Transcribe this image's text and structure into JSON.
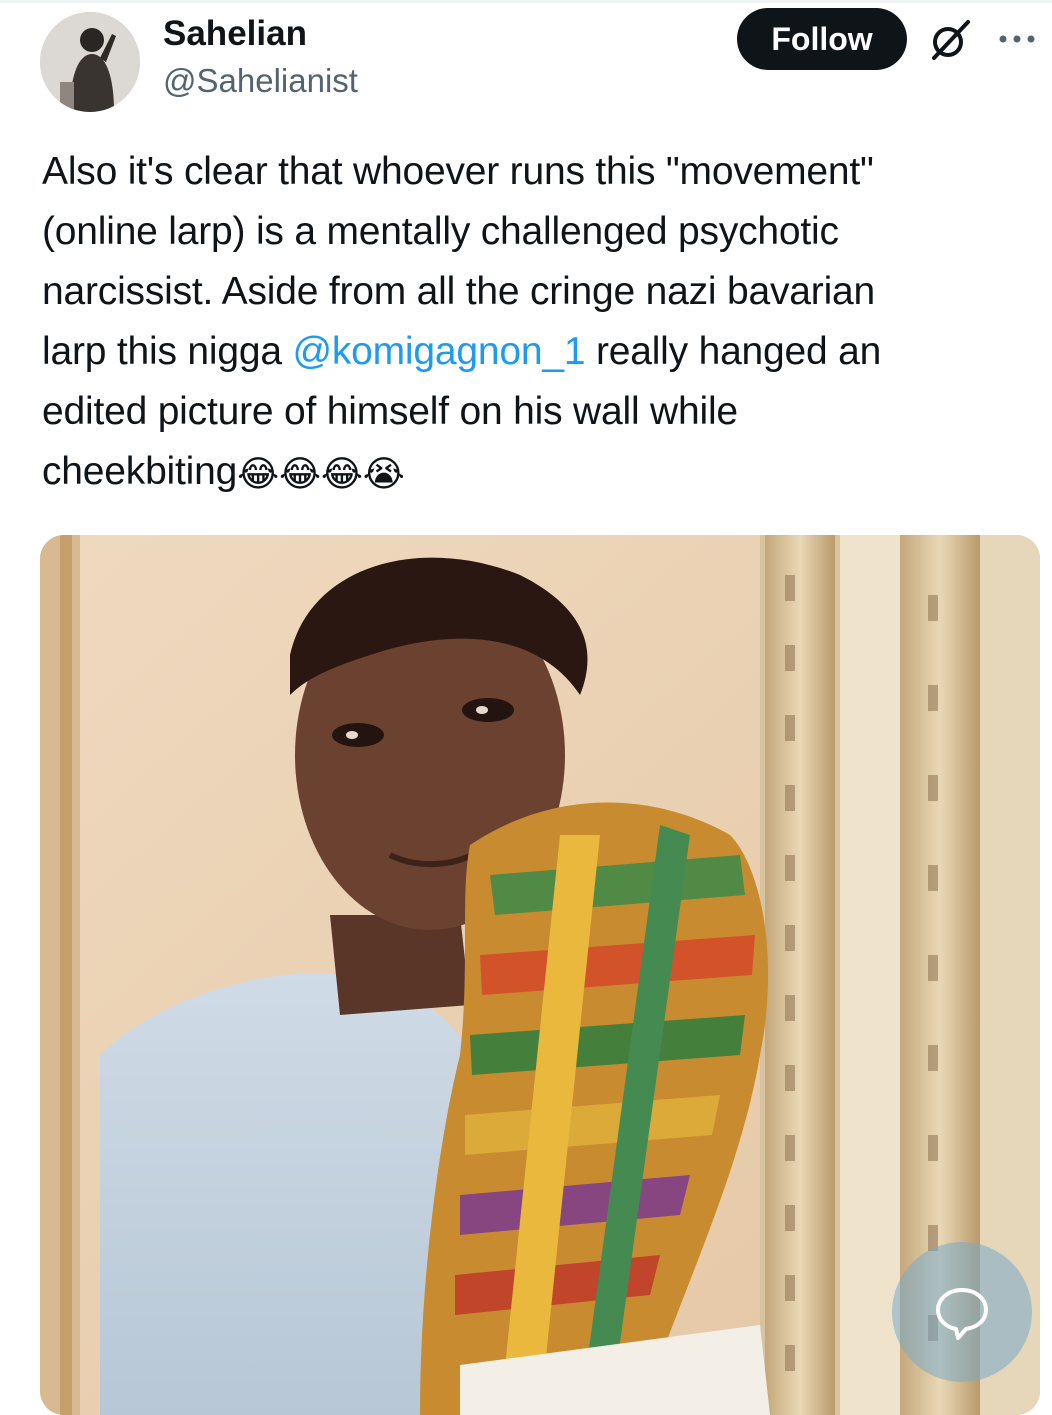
{
  "author": {
    "display_name": "Sahelian",
    "handle": "@Sahelianist",
    "avatar_icon": "profile-photo"
  },
  "actions": {
    "follow_label": "Follow",
    "grok_icon": "grok-icon",
    "more_icon": "more-icon"
  },
  "tweet": {
    "lines": [
      "Also it's clear that whoever runs this \"movement\"",
      "(online larp) is a mentally challenged psychotic",
      "narcissist. Aside from all the cringe nazi bavarian"
    ],
    "line4_before": "larp this nigga ",
    "mention": "@komigagnon_1",
    "line4_after": " really hanged an",
    "line5": "edited picture of himself on his wall while",
    "line6": "cheekbiting",
    "emojis": [
      "😂",
      "😂",
      "😂",
      "😭"
    ]
  },
  "media": {
    "description_icon": "framed-portrait-photo"
  },
  "floating": {
    "icon": "chat-bubble-icon"
  },
  "colors": {
    "text": "#0f1419",
    "secondary": "#536471",
    "link": "#1d9bf0",
    "follow_bg": "#0f1419"
  }
}
